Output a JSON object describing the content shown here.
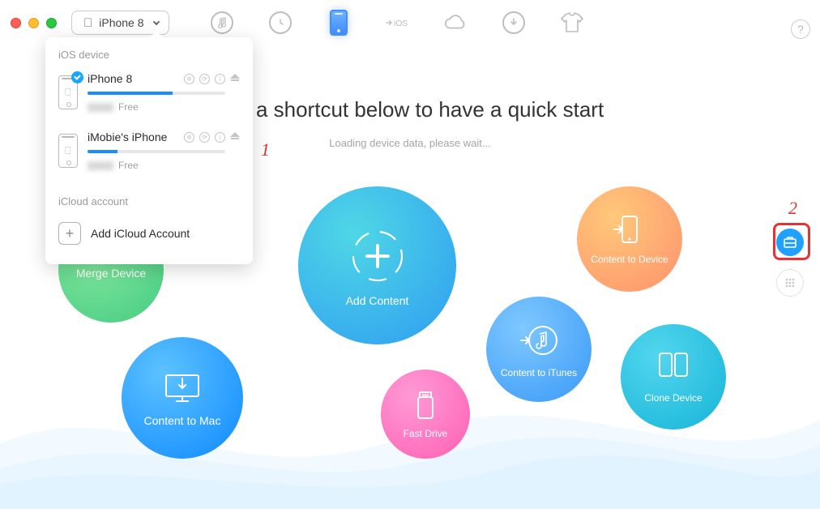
{
  "toolbar": {
    "selected_device": "iPhone 8"
  },
  "dropdown": {
    "ios_title": "iOS device",
    "icloud_title": "iCloud account",
    "add_icloud_label": "Add iCloud Account",
    "devices": [
      {
        "name": "iPhone 8",
        "free_label": "Free",
        "fill_percent": 62,
        "selected": true
      },
      {
        "name": "iMobie's iPhone",
        "free_label": "Free",
        "fill_percent": 22,
        "selected": false
      }
    ]
  },
  "callouts": {
    "one": "1",
    "two": "2"
  },
  "main": {
    "title_suffix": "ose a shortcut below to have a quick start",
    "subtitle": "Loading device data, please wait..."
  },
  "bubbles": {
    "merge": "Merge Device",
    "add": "Add Content",
    "c2d": "Content to Device",
    "c2m": "Content to Mac",
    "fast": "Fast Drive",
    "c2i": "Content to iTunes",
    "clone": "Clone Device"
  }
}
